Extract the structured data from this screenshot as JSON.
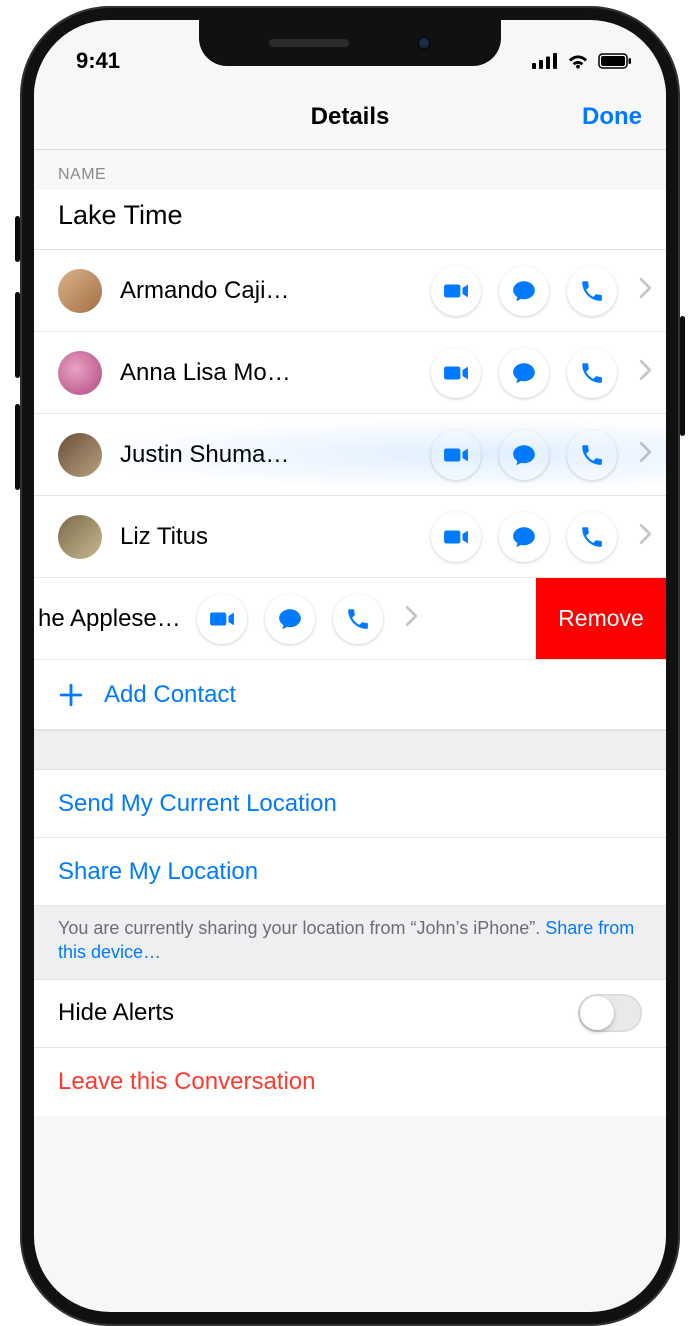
{
  "status": {
    "time": "9:41"
  },
  "nav": {
    "title": "Details",
    "done": "Done"
  },
  "name_section": {
    "header": "NAME",
    "value": "Lake Time"
  },
  "contacts": [
    {
      "name": "Armando Caji…"
    },
    {
      "name": "Anna Lisa Mo…"
    },
    {
      "name": "Justin Shuma…"
    },
    {
      "name": "Liz Titus"
    }
  ],
  "swiped": {
    "name_fragment": "he Applese…",
    "remove": "Remove"
  },
  "add_contact": "Add Contact",
  "location": {
    "send": "Send My Current Location",
    "share": "Share My Location",
    "note_prefix": "You are currently sharing your location from “John’s iPhone”. ",
    "note_link": "Share from this device…"
  },
  "alerts": {
    "label": "Hide Alerts",
    "on": false
  },
  "leave": "Leave this Conversation",
  "colors": {
    "tint": "#007aff",
    "destructive": "#ff3b30",
    "remove_bg": "#ff0000"
  }
}
